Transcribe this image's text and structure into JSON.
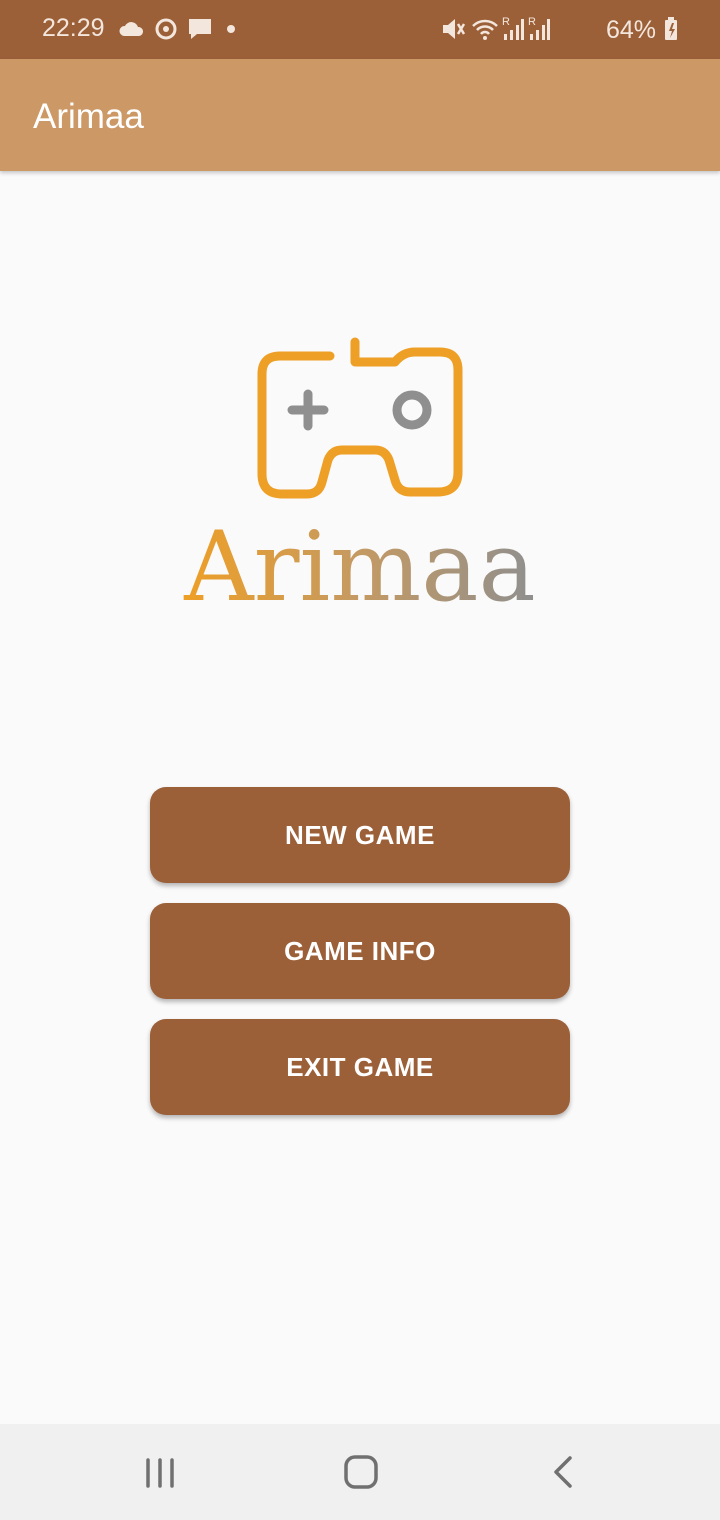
{
  "status_bar": {
    "time": "22:29",
    "battery": "64%",
    "icons": [
      "cloud-icon",
      "sync-icon",
      "message-icon",
      "dot-icon",
      "mute-icon",
      "wifi-icon",
      "signal-icon",
      "signal-icon",
      "battery-icon"
    ]
  },
  "app_bar": {
    "title": "Arimaa"
  },
  "logo": {
    "text": "Arimaa",
    "icon": "gamepad-icon"
  },
  "buttons": {
    "new_game": "NEW GAME",
    "game_info": "GAME INFO",
    "exit_game": "EXIT GAME"
  },
  "nav_bar": {
    "icons": [
      "recent-apps-icon",
      "home-icon",
      "back-icon"
    ]
  },
  "colors": {
    "status_bar": "#9c6039",
    "app_bar": "#cc9866",
    "button": "#9c6039",
    "logo_orange": "#ee9f26",
    "logo_gray": "#8f8f8f"
  }
}
